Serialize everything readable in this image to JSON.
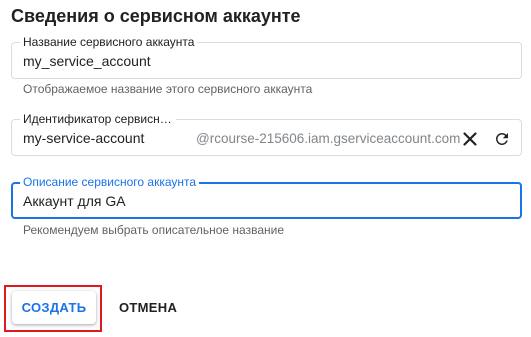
{
  "section": {
    "title": "Сведения о сервисном аккаунте"
  },
  "fields": {
    "name": {
      "label": "Название сервисного аккаунта",
      "value": "my_service_account",
      "hint": "Отображаемое название этого сервисного аккаунта"
    },
    "id": {
      "label": "Идентификатор сервисного аккаунта",
      "value": "my-service-account",
      "suffix": "@rcourse-215606.iam.gserviceaccount.com",
      "clear_icon": "close-icon",
      "refresh_icon": "refresh-icon"
    },
    "description": {
      "label": "Описание сервисного аккаунта",
      "value": "Аккаунт для GA",
      "hint": "Рекомендуем выбрать описательное название"
    }
  },
  "actions": {
    "create_label": "СОЗДАТЬ",
    "cancel_label": "ОТМЕНА"
  },
  "colors": {
    "accent": "#1a73e8",
    "highlight": "#e0191f",
    "border": "#dadce0"
  }
}
